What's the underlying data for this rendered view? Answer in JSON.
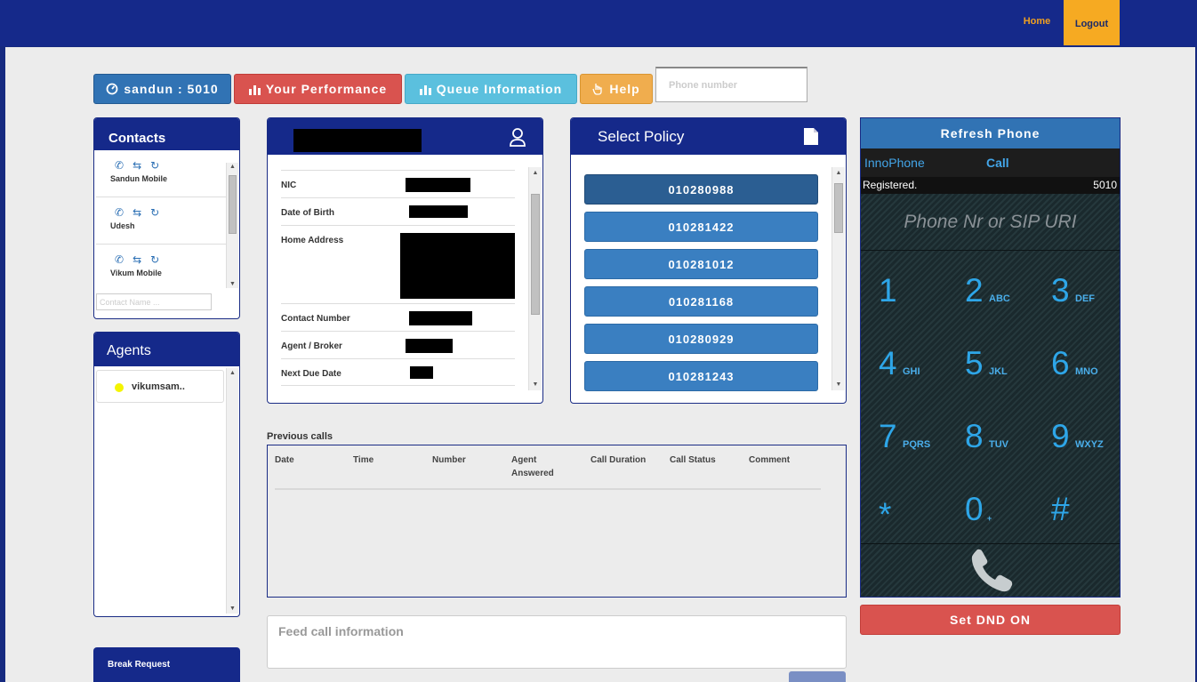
{
  "nav": {
    "home_label": "Home",
    "logout_label": "Logout"
  },
  "toolbar": {
    "user_label": "sandun : 5010",
    "performance_label": "Your Performance",
    "queue_label": "Queue Information",
    "help_label": "Help",
    "phone_placeholder": "Phone number"
  },
  "contacts": {
    "title": "Contacts",
    "items": [
      {
        "name": "Sandun Mobile"
      },
      {
        "name": "Udesh"
      },
      {
        "name": "Vikum Mobile"
      }
    ],
    "search_placeholder": "Contact Name ..."
  },
  "agents": {
    "title": "Agents",
    "items": [
      {
        "name": "vikumsam..",
        "status_color": "#f4f400"
      }
    ]
  },
  "break_request": {
    "label": "Break Request"
  },
  "customer": {
    "fields": [
      {
        "label": "NIC"
      },
      {
        "label": "Date of Birth"
      },
      {
        "label": "Home Address"
      },
      {
        "label": "Contact Number"
      },
      {
        "label": "Agent / Broker"
      },
      {
        "label": "Next Due Date"
      }
    ]
  },
  "policy": {
    "title": "Select Policy",
    "items": [
      "010280988",
      "010281422",
      "010281012",
      "010281168",
      "010280929",
      "010281243"
    ]
  },
  "previous_calls": {
    "title": "Previous calls",
    "columns": [
      "Date",
      "Time",
      "Number",
      "Agent Answered",
      "Call Duration",
      "Call Status",
      "Comment"
    ]
  },
  "feed": {
    "placeholder": "Feed call information"
  },
  "phone": {
    "refresh_label": "Refresh Phone",
    "brand": "InnoPhone",
    "call_tab": "Call",
    "status": "Registered.",
    "extension": "5010",
    "dial_placeholder": "Phone Nr or SIP URI",
    "keys": [
      {
        "num": "1",
        "letters": ""
      },
      {
        "num": "2",
        "letters": "ABC"
      },
      {
        "num": "3",
        "letters": "DEF"
      },
      {
        "num": "4",
        "letters": "GHI"
      },
      {
        "num": "5",
        "letters": "JKL"
      },
      {
        "num": "6",
        "letters": "MNO"
      },
      {
        "num": "7",
        "letters": "PQRS"
      },
      {
        "num": "8",
        "letters": "TUV"
      },
      {
        "num": "9",
        "letters": "WXYZ"
      },
      {
        "num": "*",
        "letters": ""
      },
      {
        "num": "0",
        "letters": "+"
      },
      {
        "num": "#",
        "letters": ""
      }
    ]
  },
  "dnd": {
    "label": "Set DND ON"
  },
  "colors": {
    "navy": "#15298a",
    "primary": "#3173b4",
    "danger": "#d9534f",
    "info": "#5bc0de",
    "warning": "#f0ad4e",
    "keypad": "#2ea6e8"
  }
}
